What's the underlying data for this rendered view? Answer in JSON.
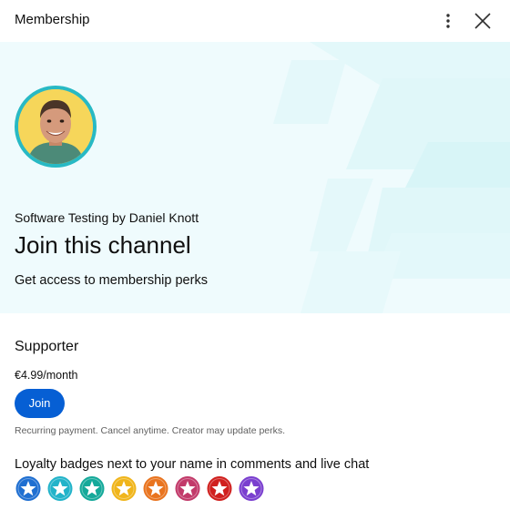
{
  "header": {
    "title": "Membership",
    "more_icon": "more-vert-icon",
    "close_icon": "close-icon"
  },
  "hero": {
    "avatar_icon": "channel-avatar",
    "channel_name": "Software Testing by Daniel Knott",
    "heading": "Join this channel",
    "subtitle": "Get access to membership perks",
    "background_color": "#effbfd"
  },
  "tier": {
    "name": "Supporter",
    "price": "€4.99/month",
    "join_label": "Join",
    "disclaimer": "Recurring payment. Cancel anytime. Creator may update perks.",
    "perk_description": "Loyalty badges next to your name in comments and live chat",
    "badges": [
      {
        "name": "badge-blue-star-icon",
        "color": "#1f6fd1"
      },
      {
        "name": "badge-teal-star-icon",
        "color": "#22b3c9"
      },
      {
        "name": "badge-green-star-icon",
        "color": "#15a99a"
      },
      {
        "name": "badge-yellow-star-icon",
        "color": "#f0b51b"
      },
      {
        "name": "badge-orange-star-icon",
        "color": "#e9741f"
      },
      {
        "name": "badge-magenta-star-icon",
        "color": "#c23a6a"
      },
      {
        "name": "badge-red-star-icon",
        "color": "#d0201e"
      },
      {
        "name": "badge-purple-star-icon",
        "color": "#7a3fcf"
      }
    ]
  },
  "colors": {
    "accent": "#065fd4",
    "avatar_ring": "#28b9c4"
  }
}
